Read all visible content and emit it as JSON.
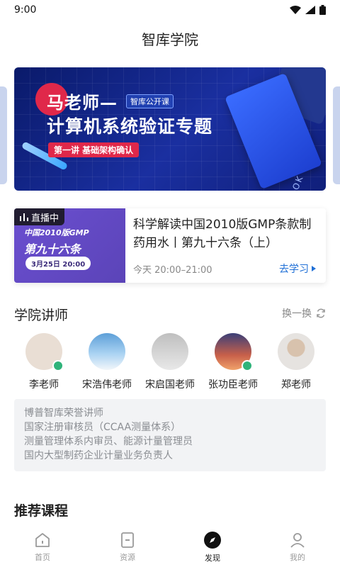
{
  "status": {
    "time": "9:00"
  },
  "header": {
    "title": "智库学院"
  },
  "banner": {
    "teacher": "马老师—",
    "tag": "智库公开课",
    "main": "计算机系统验证专题",
    "sub": "第一讲 基础架构确认",
    "notebook": "NOTEBOOK"
  },
  "live": {
    "badge": "直播中",
    "thumb_line1": "中国2010版GMP",
    "thumb_line2": "第九十六条",
    "thumb_date": "3月25日 20:00",
    "title": "科学解读中国2010版GMP条款制药用水丨第九十六条（上）",
    "time": "今天 20:00–21:00",
    "action": "去学习"
  },
  "instructors": {
    "title": "学院讲师",
    "refresh": "换一换",
    "teachers": [
      {
        "name": "李老师",
        "verified": true,
        "color": "#e9ded4"
      },
      {
        "name": "宋浩伟老师",
        "verified": false,
        "color": "#5d9fd8"
      },
      {
        "name": "宋启国老师",
        "verified": false,
        "color": "#cfcfcf"
      },
      {
        "name": "张功臣老师",
        "verified": true,
        "color": "#c8604a"
      },
      {
        "name": "郑老师",
        "verified": false,
        "color": "#e6e3e0"
      }
    ],
    "bio": [
      "博普智库荣誉讲师",
      "国家注册审核员（CCAA测量体系）",
      "测量管理体系内审员、能源计量管理员",
      "国内大型制药企业计量业务负责人"
    ]
  },
  "recommended": {
    "title": "推荐课程"
  },
  "tabbar": {
    "tabs": [
      {
        "label": "首页",
        "icon": "home-icon"
      },
      {
        "label": "资源",
        "icon": "resource-icon"
      },
      {
        "label": "发现",
        "icon": "compass-icon",
        "active": true
      },
      {
        "label": "我的",
        "icon": "user-icon"
      }
    ]
  }
}
